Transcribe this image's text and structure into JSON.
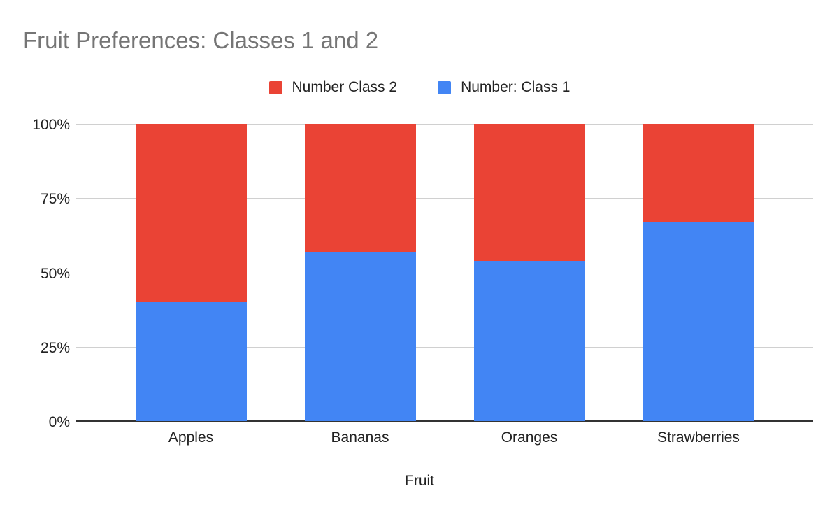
{
  "chart_data": {
    "type": "bar",
    "subtype": "stacked-percent",
    "title": "Fruit Preferences: Classes 1 and 2",
    "subtitle": "",
    "xlabel": "Fruit",
    "ylabel": "",
    "categories": [
      "Apples",
      "Bananas",
      "Oranges",
      "Strawberries"
    ],
    "series": [
      {
        "name": "Number Class 2",
        "values": [
          60,
          43,
          46,
          33
        ],
        "color": "#EA4335",
        "stack_position": "top"
      },
      {
        "name": "Number: Class 1",
        "values": [
          40,
          57,
          54,
          67
        ],
        "color": "#4285F4",
        "stack_position": "bottom"
      }
    ],
    "ylim": [
      0,
      100
    ],
    "ytick_values": [
      0,
      25,
      50,
      75,
      100
    ],
    "ytick_labels": [
      "0%",
      "25%",
      "50%",
      "75%",
      "100%"
    ],
    "grid": true,
    "grid_axis": "y",
    "legend_position": "top-center",
    "value_unit": "percent"
  },
  "title": {
    "text": "Fruit Preferences: Classes 1 and 2",
    "color": "#757575"
  },
  "legend": {
    "items": [
      {
        "label": "Number Class 2",
        "color": "#EA4335"
      },
      {
        "label": "Number: Class 1",
        "color": "#4285F4"
      }
    ]
  },
  "axes": {
    "x_title": "Fruit",
    "y_ticks": [
      "0%",
      "25%",
      "50%",
      "75%",
      "100%"
    ],
    "x_ticks": [
      "Apples",
      "Bananas",
      "Oranges",
      "Strawberries"
    ]
  },
  "colors": {
    "class1": "#4285F4",
    "class2": "#EA4335",
    "gridline": "#d0d0d0",
    "axis": "#333333",
    "text": "#222222",
    "title": "#757575",
    "background": "#ffffff"
  }
}
